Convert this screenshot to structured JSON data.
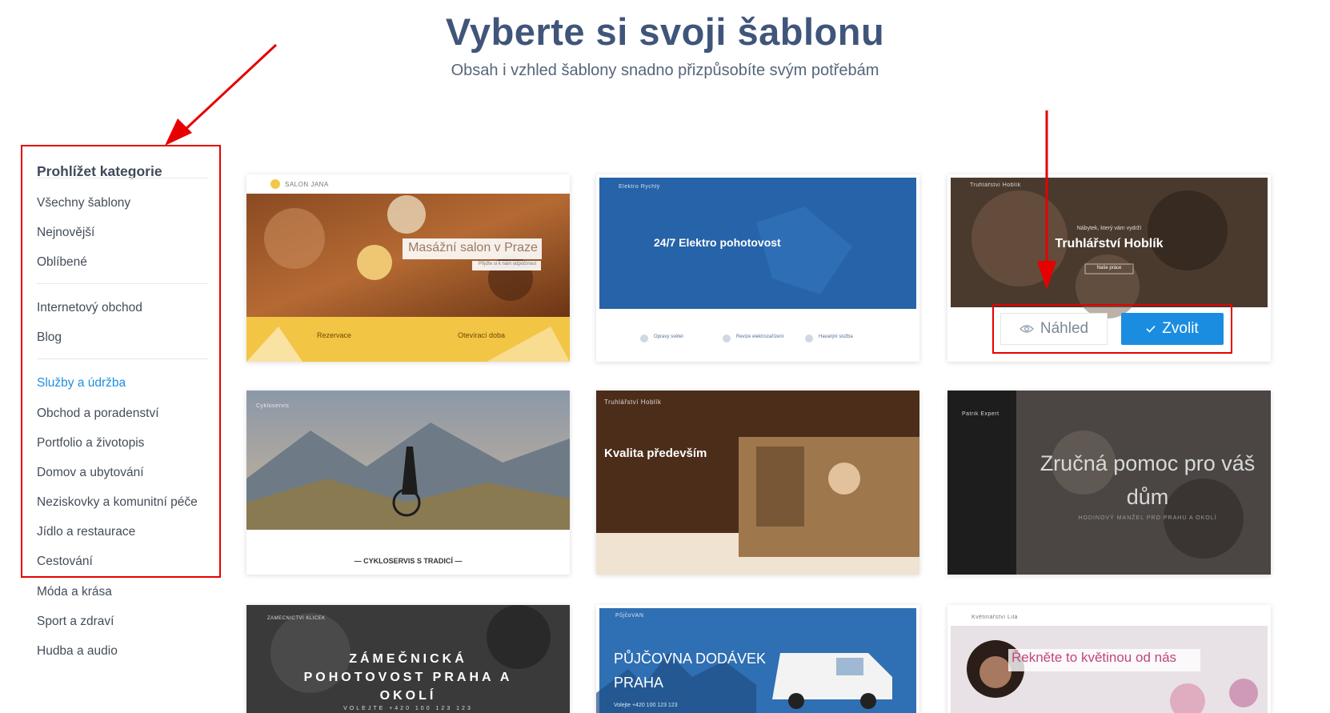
{
  "page": {
    "title": "Vyberte si svoji šablonu",
    "subtitle": "Obsah i vzhled šablony snadno přizpůsobíte svým potřebám"
  },
  "sidebar": {
    "heading": "Prohlížet kategorie",
    "groups": [
      [
        "Všechny šablony",
        "Nejnovější",
        "Oblíbené"
      ],
      [
        "Internetový obchod",
        "Blog"
      ],
      [
        "Služby a údržba",
        "Obchod a poradenství",
        "Portfolio a životopis",
        "Domov a ubytování",
        "Neziskovky a komunitní péče",
        "Jídlo a restaurace",
        "Cestování",
        "Móda a krása",
        "Sport a zdraví",
        "Hudba a audio"
      ]
    ],
    "active": "Služby a údržba"
  },
  "templates": {
    "salon": {
      "brand": "SALON JANA",
      "hero": "Masážní salon v Praze",
      "cta": "Přijďte si k nám odpočinout",
      "left": "Rezervace",
      "right": "Otevírací doba"
    },
    "elektro": {
      "brand": "Elektro Rychlý",
      "hero": "24/7 Elektro pohotovost",
      "services": [
        "Opravy světel",
        "Revize elektrozařízení",
        "Havarijní služba"
      ]
    },
    "hoblik1": {
      "brand": "Truhlářství Hoblík",
      "kicker": "Nábytek, který vám vydrží",
      "hero": "Truhlářství Hoblík",
      "button": "Naše práce"
    },
    "cyklo": {
      "brand": "Cykloservis",
      "tagline": "— CYKLOSERVIS S TRADICÍ —"
    },
    "hoblik2": {
      "brand": "Truhlářství Hoblík",
      "hero": "Kvalita především"
    },
    "expert": {
      "brand": "Patrik Expert",
      "hero": "Zručná pomoc pro váš dům",
      "sub": "HODINOVÝ MANŽEL PRO PRAHU A OKOLÍ"
    },
    "zamek": {
      "brand": "ZÁMEČNICTVÍ KLÍČEK",
      "hero": "ZÁMEČNICKÁ POHOTOVOST PRAHA A OKOLÍ",
      "phone": "VOLEJTE +420 100 123 123"
    },
    "pujcovna": {
      "brand": "PůjčoVAN",
      "hero": "PŮJČOVNA DODÁVEK PRAHA",
      "phone": "Volejte +420 100 123 123"
    },
    "kvetiny": {
      "brand": "Květinářství Lila",
      "hero": "Řekněte to květinou od nás"
    }
  },
  "actions": {
    "preview_label": "Náhled",
    "choose_label": "Zvolit",
    "preview_icon": "eye-icon",
    "choose_icon": "check-icon"
  },
  "colors": {
    "accent": "#1a8de0",
    "highlight": "#e60000",
    "title": "#40557a"
  }
}
